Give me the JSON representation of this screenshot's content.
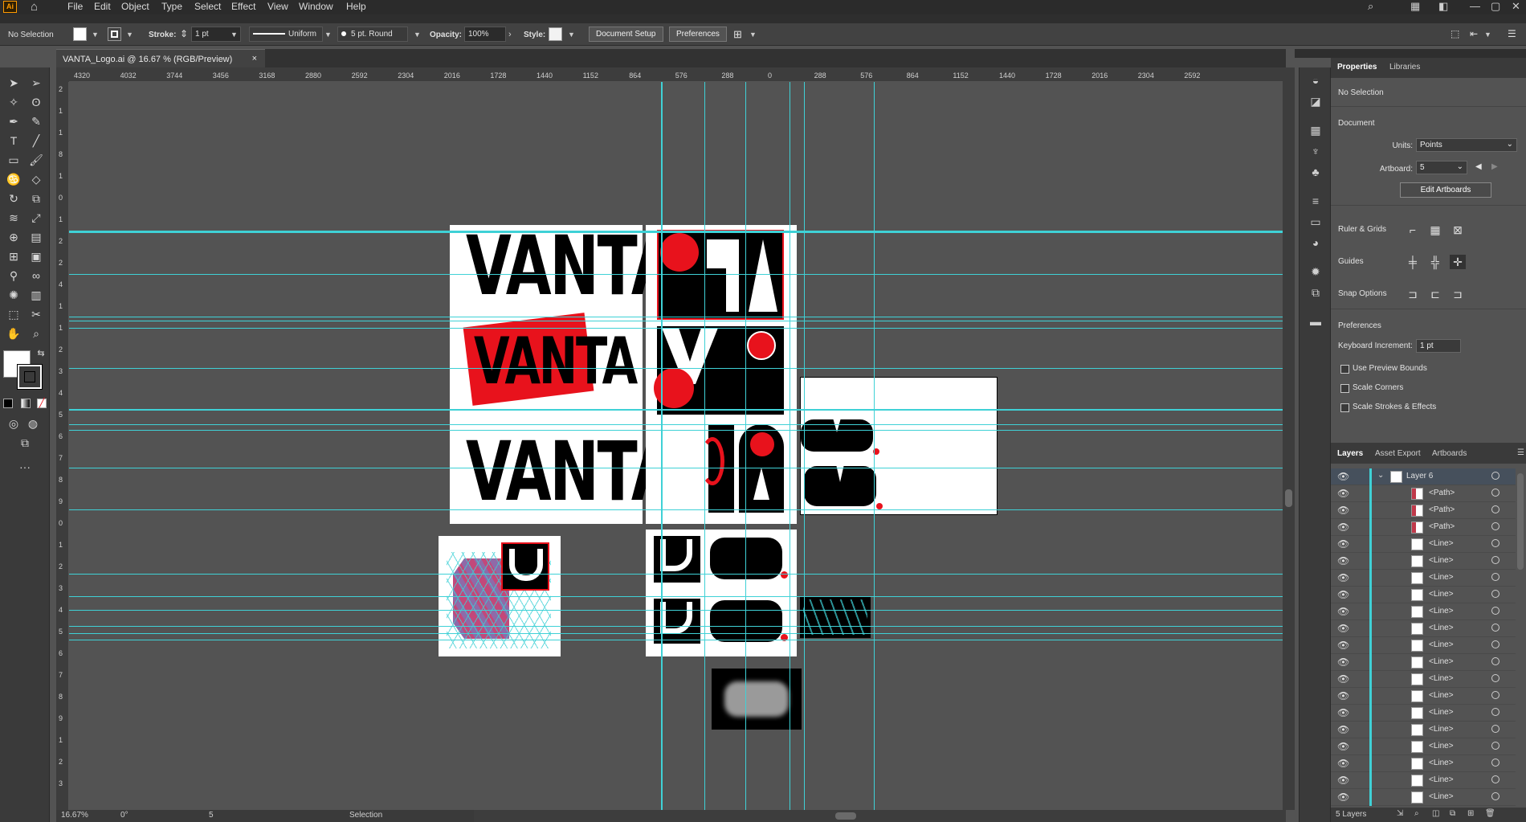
{
  "app": {
    "logo": "Ai",
    "menu": [
      "File",
      "Edit",
      "Object",
      "Type",
      "Select",
      "Effect",
      "View",
      "Window",
      "Help"
    ]
  },
  "control_bar": {
    "selection": "No Selection",
    "stroke_label": "Stroke:",
    "stroke_value": "1 pt",
    "profile": "Uniform",
    "brush": "5 pt. Round",
    "opacity_label": "Opacity:",
    "opacity_value": "100%",
    "style_label": "Style:",
    "document_setup": "Document Setup",
    "preferences": "Preferences"
  },
  "document_tab": {
    "title": "VANTA_Logo.ai @ 16.67 % (RGB/Preview)",
    "close": "×"
  },
  "ruler": {
    "h_ticks": [
      "4320",
      "4032",
      "3744",
      "3456",
      "3168",
      "2880",
      "2592",
      "2304",
      "2016",
      "1728",
      "1440",
      "1152",
      "864",
      "576",
      "288",
      "0",
      "288",
      "576",
      "864",
      "1152",
      "1440",
      "1728",
      "2016",
      "2304",
      "2592"
    ],
    "v_ticks": [
      "2",
      "1",
      "1",
      "8",
      "1",
      "0",
      "1",
      "2",
      "2",
      "4",
      "1",
      "1",
      "2",
      "3",
      "4",
      "5",
      "6",
      "7",
      "8",
      "9",
      "0",
      "1",
      "2",
      "3",
      "4",
      "5",
      "6",
      "7",
      "8",
      "9",
      "1",
      "2",
      "3"
    ]
  },
  "artwork": {
    "wordmark": "VANTA",
    "wordmark_red": "VANTA",
    "wordmark_bottom": "VANTA"
  },
  "status_bar": {
    "zoom": "16.67%",
    "rotation": "0°",
    "artboard": "5",
    "tool": "Selection"
  },
  "properties": {
    "tabs": [
      "Properties",
      "Libraries"
    ],
    "selection": "No Selection",
    "document_label": "Document",
    "units_label": "Units:",
    "units_value": "Points",
    "artboard_label": "Artboard:",
    "artboard_value": "5",
    "edit_artboards": "Edit Artboards",
    "ruler_grids": "Ruler & Grids",
    "guides": "Guides",
    "snap_options": "Snap Options",
    "preferences_label": "Preferences",
    "keyboard_increment_label": "Keyboard Increment:",
    "keyboard_increment_value": "1 pt",
    "use_preview_bounds": "Use Preview Bounds",
    "scale_corners": "Scale Corners",
    "scale_strokes": "Scale Strokes & Effects"
  },
  "layers_panel": {
    "tabs": [
      "Layers",
      "Asset Export",
      "Artboards"
    ],
    "rows": [
      "Layer 6",
      "<Path>",
      "<Path>",
      "<Path>",
      "<Line>",
      "<Line>",
      "<Line>",
      "<Line>",
      "<Line>",
      "<Line>",
      "<Line>",
      "<Line>",
      "<Line>",
      "<Line>",
      "<Line>",
      "<Line>",
      "<Line>",
      "<Line>",
      "<Line>",
      "<Line>"
    ],
    "footer": "5 Layers"
  },
  "colors": {
    "guide": "#3fd1d6",
    "accent_red": "#e8121c",
    "canvas": "#535353"
  }
}
